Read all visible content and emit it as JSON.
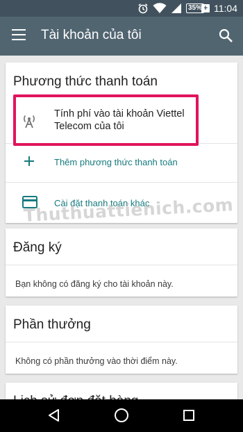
{
  "status_bar": {
    "battery": "35%",
    "time": "11:04"
  },
  "app_bar": {
    "title": "Tài khoản của tôi"
  },
  "payment_card": {
    "title": "Phương thức thanh toán",
    "carrier_billing": "Tính phí vào tài khoản Viettel Telecom của tôi",
    "carrier_billing_line1": "Tính phí vào tài khoản Viettel",
    "carrier_billing_line2": "Telecom của tôi",
    "add_method": "Thêm phương thức thanh toán",
    "other_settings": "Cài đặt thanh toán khác"
  },
  "subscriptions_card": {
    "title": "Đăng ký",
    "empty_text": "Bạn không có đăng ký cho tài khoản này."
  },
  "rewards_card": {
    "title": "Phần thưởng",
    "empty_text": "Không có phần thưởng vào thời điểm này."
  },
  "order_history_card": {
    "title": "Lịch sử đơn đặt hàng"
  },
  "watermark": "Thuthuattienich.com",
  "colors": {
    "accent": "#177a7e",
    "appbar": "#516571",
    "statusbar": "#41525e",
    "highlight": "#e0145c"
  }
}
